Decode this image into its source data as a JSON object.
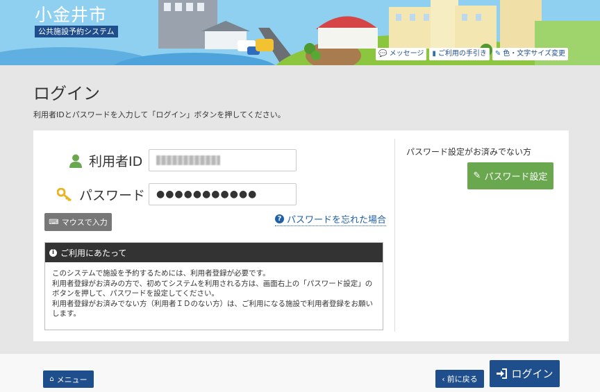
{
  "header": {
    "city_name": "小金井市",
    "system_name": "公共施設予約システム",
    "links": [
      {
        "icon": "speech-bubble-icon",
        "label": "メッセージ"
      },
      {
        "icon": "book-icon",
        "label": "ご利用の手引き"
      },
      {
        "icon": "brush-icon",
        "label": "色・文字サイズ変更"
      }
    ]
  },
  "page": {
    "title": "ログイン",
    "instruction": "利用者IDとパスワードを入力して「ログイン」ボタンを押してください。"
  },
  "form": {
    "user_id_label": "利用者ID",
    "user_id_value": "",
    "password_label": "パスワード",
    "password_value": "●●●●●●●●●●●",
    "mouse_input_label": "マウスで入力",
    "forgot_password_label": "パスワードを忘れた場合"
  },
  "notice": {
    "heading": "ご利用にあたって",
    "lines": [
      "このシステムで施設を予約するためには、利用者登録が必要です。",
      "利用者登録がお済みの方で、初めてシステムを利用される方は、画面右上の「パスワード設定」の",
      "ボタンを押して、パスワードを設定してください。",
      "利用者登録がお済みでない方（利用者ＩＤのない方）は、ご利用になる施設で利用者登録をお願い",
      "します。"
    ]
  },
  "password_setup": {
    "note": "パスワード設定がお済みでない方",
    "button_label": "パスワード設定"
  },
  "footer": {
    "menu_label": "メニュー",
    "back_label": "前に戻る",
    "login_label": "ログイン"
  },
  "colors": {
    "brand_blue": "#1f4e8c",
    "green_button": "#6aa84f",
    "sky": "#7fc8ee"
  }
}
